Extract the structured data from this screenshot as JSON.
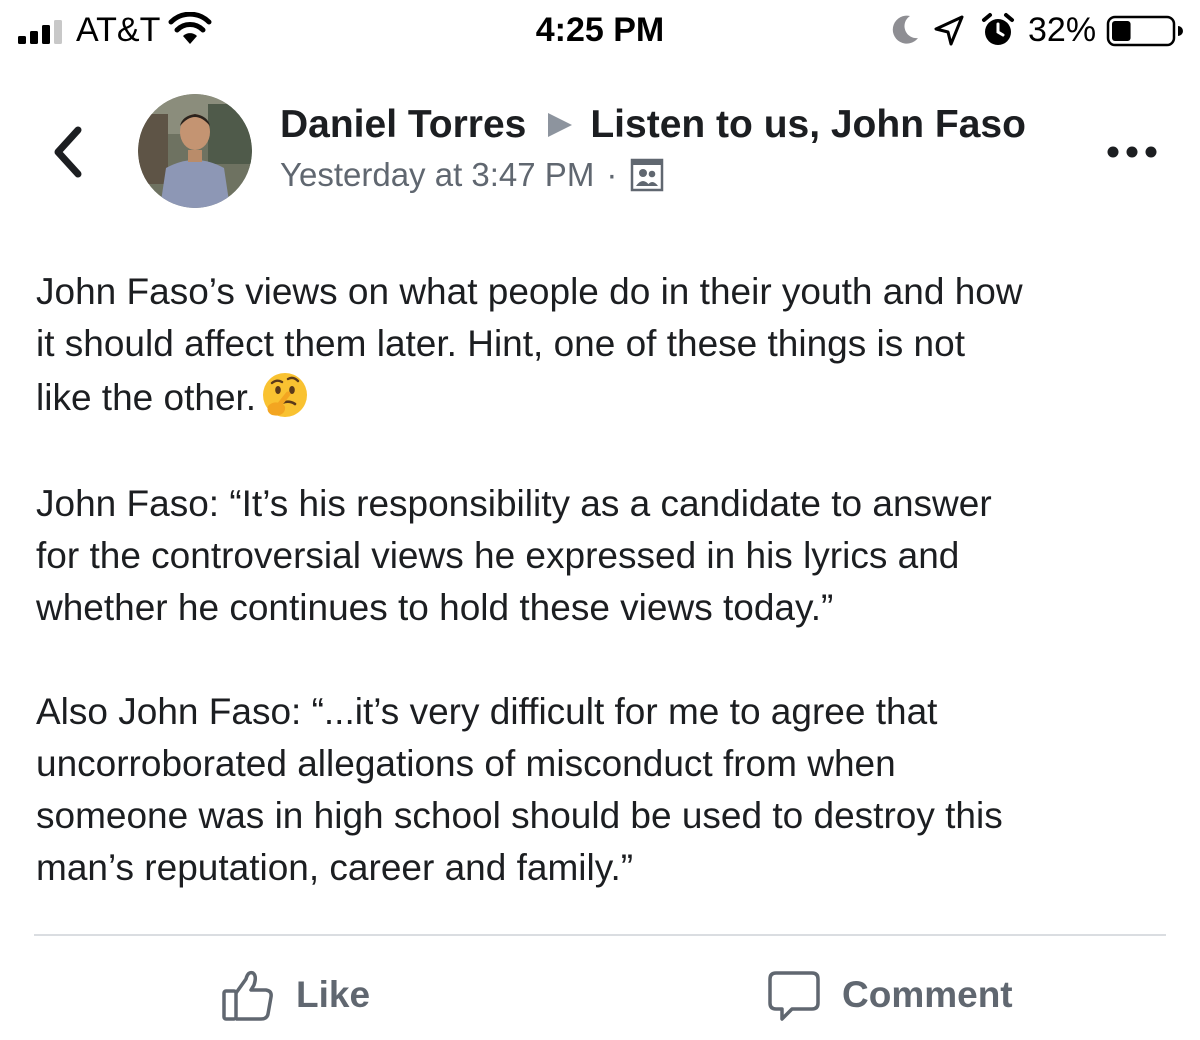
{
  "status_bar": {
    "carrier": "AT&T",
    "time": "4:25 PM",
    "battery_percent": "32%",
    "battery_level": 0.32,
    "signal_bars_filled": 3,
    "icons": [
      "signal-icon",
      "wifi-icon",
      "moon-icon",
      "location-arrow-icon",
      "alarm-icon",
      "battery-icon"
    ]
  },
  "nav": {
    "back_icon": "chevron-left-icon",
    "more_icon": "more-dots-icon"
  },
  "post": {
    "author": "Daniel Torres",
    "share_arrow_icon": "triangle-right-icon",
    "target": "Listen to us, John Faso",
    "timestamp": "Yesterday at 3:47 PM",
    "separator": "·",
    "audience_icon": "group-audience-icon",
    "paragraphs": [
      "John Faso’s views on what people do in their youth and how\nit should affect them later. Hint, one of these things is not\nlike the other.",
      "John Faso: “It’s his responsibility as a candidate to answer\nfor the controversial views he expressed in his lyrics and\nwhether he continues to hold these views today.”",
      "Also John Faso: “...it’s very difficult for me to agree that\nuncorroborated allegations of misconduct from when\nsomeone was in high school should be used to destroy this\nman’s reputation, career and family.”"
    ],
    "emoji": "thinking-face-emoji"
  },
  "actions": {
    "like_label": "Like",
    "like_icon": "thumbs-up-icon",
    "comment_label": "Comment",
    "comment_icon": "comment-bubble-icon"
  },
  "colors": {
    "text_primary": "#1c1e21",
    "text_secondary": "#606770",
    "divider": "#dadde1",
    "emoji_yellow": "#f9c231"
  }
}
